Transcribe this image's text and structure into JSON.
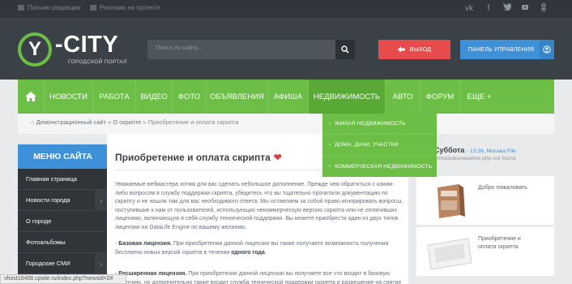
{
  "topbar": {
    "link1": "Письмо редакции",
    "link2": "Реклама на проекте",
    "social": [
      "vk-icon",
      "facebook-icon",
      "twitter-icon",
      "youtube-icon",
      "odnoklassniki-icon"
    ]
  },
  "header": {
    "logo_letter": "Y",
    "logo_text": "-CITY",
    "logo_sub": "ГОРОДСКОЙ ПОРТАЛ",
    "search_placeholder": "Поиск по сайту...",
    "exit_label": "ВЫХОД",
    "panel_label": "ПАНЕЛЬ УПРАВЛЕНИЯ"
  },
  "nav": {
    "items": [
      "НОВОСТИ",
      "РАБОТА",
      "ВИДЕО",
      "ФОТО",
      "ОБЪЯВЛЕНИЯ",
      "АФИША",
      "НЕДВИЖИМОСТЬ",
      "АВТО",
      "ФОРУМ",
      "ЕЩЕ +"
    ],
    "active": "НЕДВИЖИМОСТЬ",
    "dropdown": [
      "ЖИЛАЯ НЕДВИЖИМОСТЬ",
      "ДОМА, ДАЧИ, УЧАСТКИ",
      "КОММЕРЧЕСКАЯ НЕДВИЖИМОСТЬ"
    ]
  },
  "breadcrumb": {
    "home": "Демонстрационный сайт",
    "sep": "»",
    "middle": "О скрипте",
    "current": "Приобретение и оплата скрипта"
  },
  "sidebar": {
    "heading": "МЕНЮ САЙТА",
    "items": [
      "Главная страница",
      "Новости города",
      "О городе",
      "Фотоальбомы",
      "Городские СМИ"
    ]
  },
  "article": {
    "title": "Приобретение и оплата скрипта",
    "intro": "Уважаемые вебмастера хотим для вас сделать небольшое дополнение. Прежде чем обратиться с каким-либо вопросом в службу поддержки скрипта, убедитесь что вы тщательно прочитали документацию по скрипту и не нашли там для вас необходимого ответа. Мы оставляем за собой право игнорировать вопросы, поступившие к нам от пользователей, использующих некоммерческую версию скрипта или не оплативших лицензию, включающую в себя службу технической поддержки. Вы можете приобрести один из двух типов лицензии на DataLife Engine по вашему желанию.",
    "basic_label": "Базовая лицензия.",
    "basic_text": "При приобретении данной лицензии вы также получаете возможность получения бесплатно новых версий скрипта в течении",
    "basic_bold": "одного года",
    "ext_label": "Расширенная лицензия.",
    "ext_text": "При приобретении данной лицензии вы получаете все что входит в базовую лицензию, но дополнительно также входит служба технической поддержки скрипта и разрешение на снятие копирайтов."
  },
  "right": {
    "weather_title": "Суббота",
    "weather_time": "- 13:36, Москва File",
    "weather_error": "e/modules/weather.php not found",
    "card1": "Добро пожаловать",
    "card2a": "Приобретение и",
    "card2b": "оплата скрипта"
  },
  "status": {
    "url": "vhost16408.cpsite.ru/index.php?newsid=2#"
  }
}
